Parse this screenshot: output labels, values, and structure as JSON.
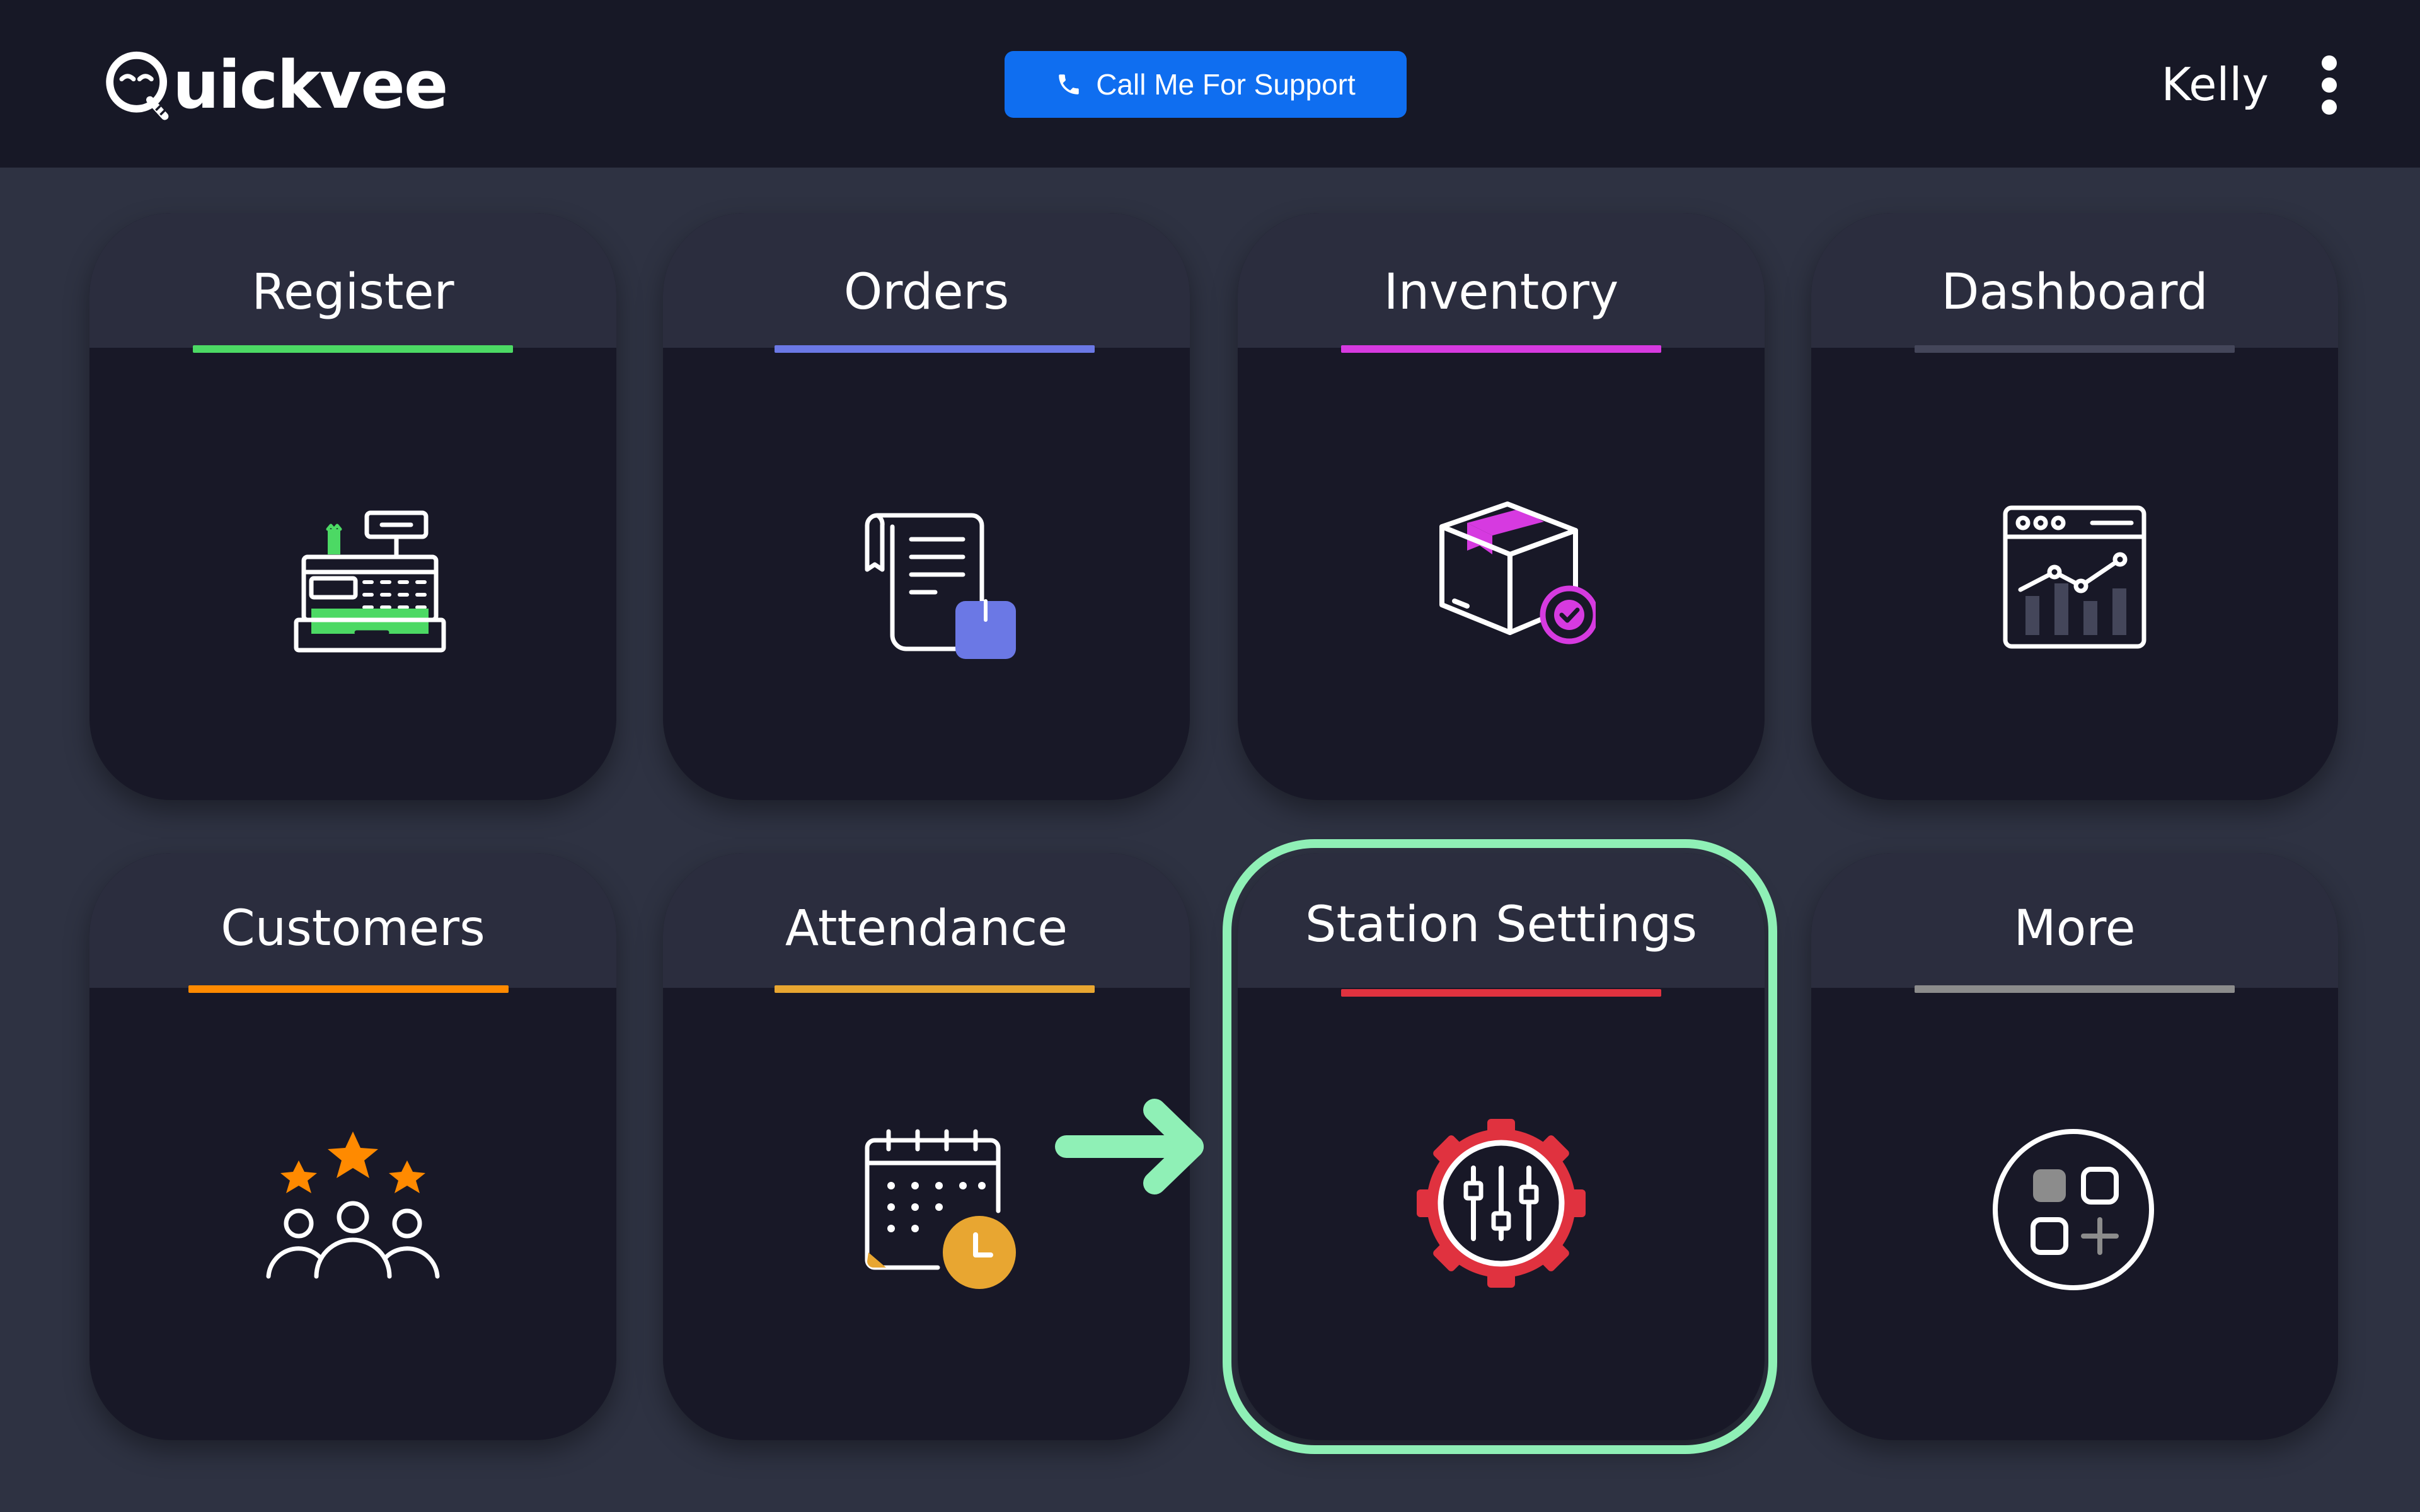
{
  "header": {
    "logo_text": "uickvee",
    "support_label": "Call Me For Support",
    "user_name": "Kelly"
  },
  "tiles": [
    {
      "label": "Register",
      "accent": "#4cd964",
      "icon": "cash-register-icon"
    },
    {
      "label": "Orders",
      "accent": "#6b78e5",
      "icon": "receipt-icon"
    },
    {
      "label": "Inventory",
      "accent": "#d63ae0",
      "icon": "package-box-icon"
    },
    {
      "label": "Dashboard",
      "accent": "#44465a",
      "icon": "analytics-chart-icon"
    },
    {
      "label": "Customers",
      "accent": "#ff8a00",
      "icon": "customers-stars-icon"
    },
    {
      "label": "Attendance",
      "accent": "#e8a631",
      "icon": "calendar-clock-icon"
    },
    {
      "label": "Station Settings",
      "accent": "#e0323f",
      "icon": "settings-gear-icon"
    },
    {
      "label": "More",
      "accent": "#8c8c8c",
      "icon": "more-apps-icon"
    }
  ],
  "colors": {
    "topbar_bg": "#171826",
    "page_bg": "#2e3242",
    "tile_bg": "#181827",
    "tile_head_bg": "#2b2d3e",
    "support_button": "#0f6ef0",
    "highlight": "#8ff0b6"
  }
}
